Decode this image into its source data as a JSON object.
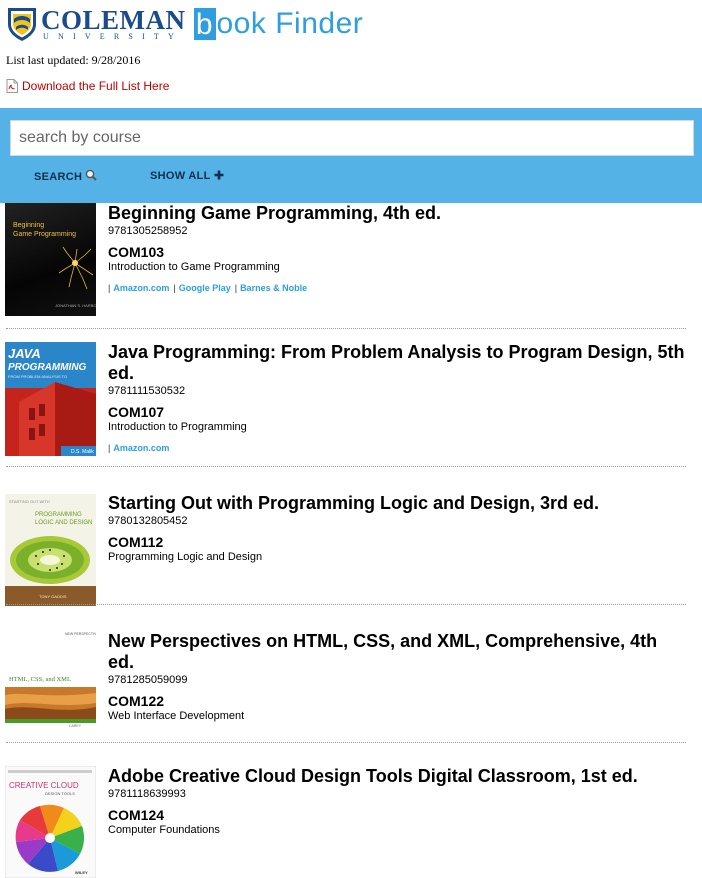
{
  "header": {
    "logo_main": "COLEMAN",
    "logo_sub": "UNIVERSITY",
    "app_b": "b",
    "app_rest": "ook Finder"
  },
  "meta": {
    "updated_label": "List last updated: 9/28/2016",
    "download_label": "Download the Full List Here"
  },
  "search": {
    "placeholder": "search by course",
    "search_label": "SEARCH",
    "showall_label": "SHOW ALL"
  },
  "colors": {
    "band": "#55b2e7",
    "brand_blue": "#1a4b8f",
    "link_blue": "#2aa0e0",
    "download_red": "#c00000"
  },
  "books": [
    {
      "title": "Beginning Game Programming, 4th ed.",
      "isbn": "9781305258952",
      "code": "COM103",
      "course": "Introduction to Game Programming",
      "cover_text": "Beginning Game Programming",
      "links": [
        "Amazon.com",
        "Google Play",
        "Barnes & Noble"
      ]
    },
    {
      "title": "Java Programming: From Problem Analysis to Program Design, 5th ed.",
      "isbn": "9781111530532",
      "code": "COM107",
      "course": "Introduction to Programming",
      "cover_text": "JAVA PROGRAMMING",
      "links": [
        "Amazon.com"
      ]
    },
    {
      "title": "Starting Out with Programming Logic and Design, 3rd ed.",
      "isbn": "9780132805452",
      "code": "COM112",
      "course": "Programming Logic and Design",
      "cover_text": "PROGRAMMING LOGIC AND DESIGN",
      "links": []
    },
    {
      "title": "New Perspectives on HTML, CSS, and XML, Comprehensive, 4th ed.",
      "isbn": "9781285059099",
      "code": "COM122",
      "course": "Web Interface Development",
      "cover_text": "HTML, CSS, and XML",
      "links": []
    },
    {
      "title": "Adobe Creative Cloud Design Tools Digital Classroom, 1st ed.",
      "isbn": "9781118639993",
      "code": "COM124",
      "course": "Computer Foundations",
      "cover_text": "CREATIVE CLOUD",
      "links": []
    }
  ]
}
